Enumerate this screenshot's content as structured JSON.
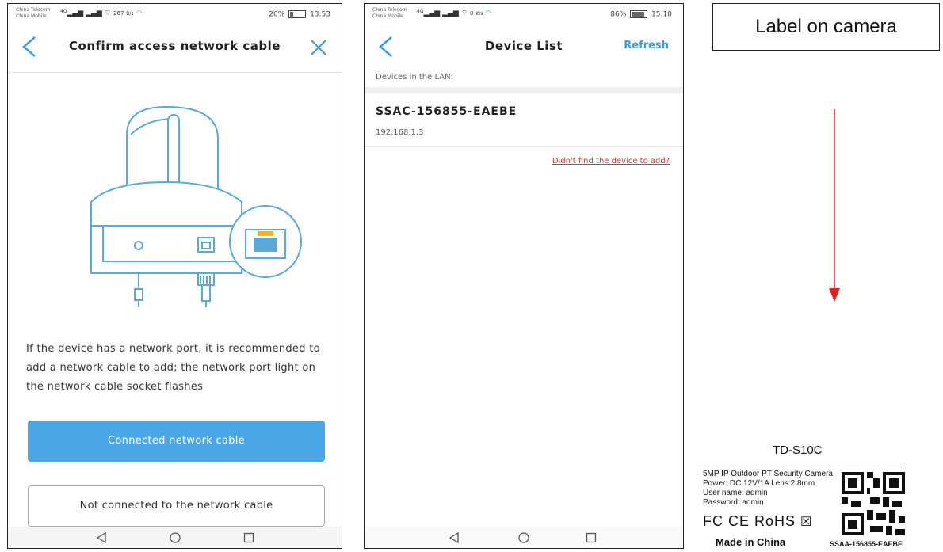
{
  "phone1": {
    "status": {
      "carrier1": "China Telecom",
      "carrier2": "China Mobile",
      "signal": "4G",
      "speed": "267",
      "speed_unit": "B/s",
      "battery": "20%",
      "time": "13:53"
    },
    "title": "Confirm access network cable",
    "description": "If the device has a network port, it is recommended to add a network cable to add; the network port light on the network cable socket flashes",
    "primary_button": "Connected network cable",
    "secondary_button": "Not connected to the network cable"
  },
  "phone2": {
    "status": {
      "carrier1": "China Telecom",
      "carrier2": "China Mobile",
      "signal": "4G",
      "speed": "0",
      "speed_unit": "K/s",
      "battery": "86%",
      "time": "15:10"
    },
    "title": "Device List",
    "refresh": "Refresh",
    "section_header": "Devices in the LAN:",
    "devices": [
      {
        "name": "SSAC-156855-EAEBE",
        "ip": "192.168.1.3"
      }
    ],
    "not_found_link": "Didn't find the device to add?"
  },
  "callout": {
    "text": "Label on camera",
    "arrow_color": "#e02020"
  },
  "camera_label": {
    "model": "TD-S10C",
    "line1": "5MP IP Outdoor PT Security Camera",
    "line2": "Power: DC 12V/1A  Lens:2.8mm",
    "line3": "User name: admin",
    "line4": "Password: admin",
    "certs": "FC CE RoHS",
    "made_in": "Made in China",
    "serial": "SSAA-156855-EAEBE"
  },
  "colors": {
    "accent": "#4ba6e6",
    "link_red": "#d33333",
    "illustration": "#5aa9d6",
    "port_light": "#f5b320"
  }
}
